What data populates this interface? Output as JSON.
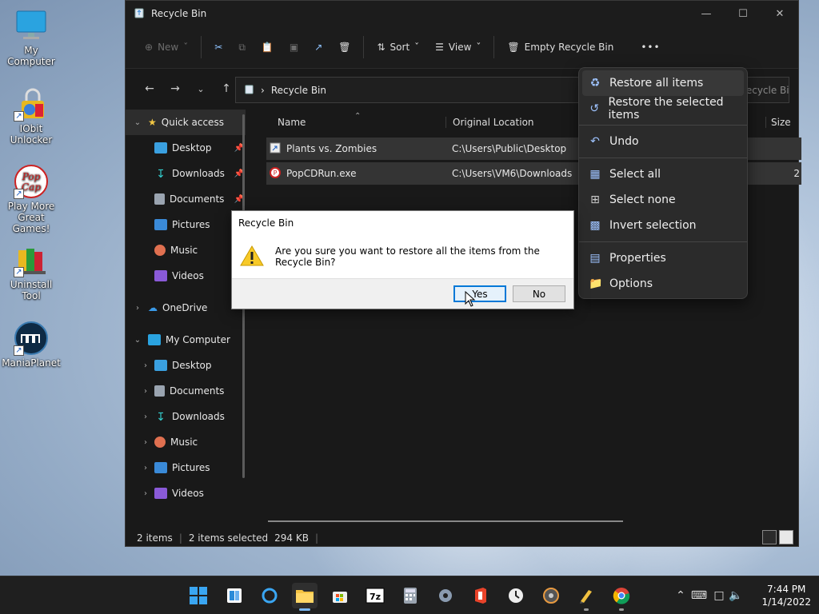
{
  "desktop": {
    "icons": [
      {
        "label": "My Computer"
      },
      {
        "label": "IObit Unlocker"
      },
      {
        "label": "Play More Great Games!"
      },
      {
        "label": "Uninstall Tool"
      },
      {
        "label": "ManiaPlanet"
      }
    ]
  },
  "window": {
    "title": "Recycle Bin",
    "toolbar": {
      "new_label": "New",
      "sort_label": "Sort",
      "view_label": "View",
      "empty_label": "Empty Recycle Bin",
      "more_label": "•••"
    },
    "address": {
      "path": "Recycle Bin"
    },
    "search": {
      "placeholder": "Search Recycle Bin"
    },
    "sidebar": {
      "quick_access": "Quick access",
      "quick_items": [
        {
          "label": "Desktop"
        },
        {
          "label": "Downloads"
        },
        {
          "label": "Documents"
        },
        {
          "label": "Pictures"
        },
        {
          "label": "Music"
        },
        {
          "label": "Videos"
        }
      ],
      "onedrive": "OneDrive",
      "my_computer": "My Computer",
      "computer_items": [
        {
          "label": "Desktop"
        },
        {
          "label": "Documents"
        },
        {
          "label": "Downloads"
        },
        {
          "label": "Music"
        },
        {
          "label": "Pictures"
        },
        {
          "label": "Videos"
        }
      ]
    },
    "columns": {
      "name": "Name",
      "location": "Original Location",
      "size": "Size"
    },
    "files": [
      {
        "name": "Plants vs. Zombies",
        "location": "C:\\Users\\Public\\Desktop",
        "size": ""
      },
      {
        "name": "PopCDRun.exe",
        "location": "C:\\Users\\VM6\\Downloads",
        "size": "2"
      }
    ],
    "status": {
      "items": "2 items",
      "selected": "2 items selected",
      "size": "294 KB"
    }
  },
  "menu": {
    "items": [
      {
        "label": "Restore all items"
      },
      {
        "label": "Restore the selected items"
      },
      {
        "label": "Undo"
      },
      {
        "label": "Select all"
      },
      {
        "label": "Select none"
      },
      {
        "label": "Invert selection"
      },
      {
        "label": "Properties"
      },
      {
        "label": "Options"
      }
    ]
  },
  "dialog": {
    "title": "Recycle Bin",
    "message": "Are you sure you want to restore all the items from the Recycle Bin?",
    "yes_label": "Yes",
    "no_label": "No"
  },
  "taskbar": {
    "time": "7:44 PM",
    "date": "1/14/2022"
  },
  "colors": {
    "accent": "#0078d7",
    "dark_bg": "#191919",
    "menu_bg": "#2b2b2b",
    "selected_row": "#343434"
  }
}
